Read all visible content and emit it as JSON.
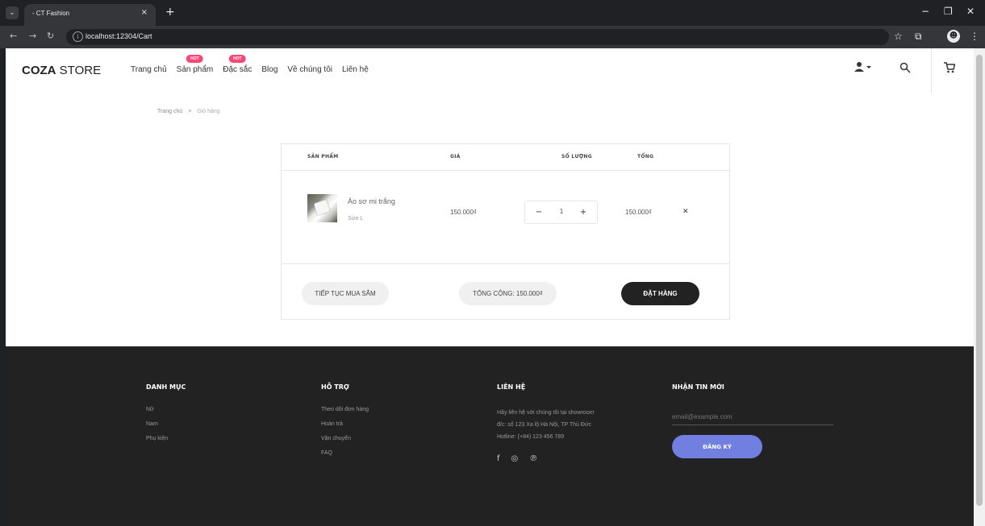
{
  "browser": {
    "tab_title": "- CT Fashion",
    "tab_close": "×",
    "new_tab": "+",
    "url": "localhost:12304/Cart",
    "minimize": "−",
    "restore": "❐",
    "close": "✕"
  },
  "header": {
    "logo_bold": "COZA",
    "logo_light": " STORE",
    "menu": [
      {
        "label": "Trang chủ",
        "badge": ""
      },
      {
        "label": "Sản phẩm",
        "badge": "HOT"
      },
      {
        "label": "Đặc sắc",
        "badge": "HOT"
      },
      {
        "label": "Blog",
        "badge": ""
      },
      {
        "label": "Về chúng tôi",
        "badge": ""
      },
      {
        "label": "Liên hệ",
        "badge": ""
      }
    ]
  },
  "breadcrumb": {
    "home": "Trang chủ",
    "separator": ">",
    "current": "Giỏ hàng"
  },
  "cart": {
    "columns": [
      "SẢN PHẨM",
      "GIÁ",
      "SỐ LƯỢNG",
      "TỔNG"
    ],
    "items": [
      {
        "name": "Áo sơ mi trắng",
        "size": "Size L",
        "price": "150.000₫",
        "quantity": "1",
        "total": "150.000₫"
      }
    ],
    "continue_label": "TIẾP TỤC MUA SẮM",
    "grand_total": "TỔNG CỘNG: 150.000₫",
    "order_label": "ĐẶT HÀNG"
  },
  "footer": {
    "categories": {
      "title": "DANH MỤC",
      "links": [
        "Nữ",
        "Nam",
        "Phụ kiện"
      ]
    },
    "support": {
      "title": "HỖ TRỢ",
      "links": [
        "Theo dõi đơn hàng",
        "Hoàn trả",
        "Vận chuyển",
        "FAQ"
      ]
    },
    "contact": {
      "title": "LIÊN HỆ",
      "lines": [
        "Hãy liên hệ với chúng tôi tại showroom",
        "đ/c: số 123 Xa lộ Hà Nội, TP Thủ Đức",
        "Hotline: (+84) 123 456 789"
      ]
    },
    "newsletter": {
      "title": "NHẬN TIN MỚI",
      "placeholder": "email@example.com",
      "button": "ĐĂNG KÝ"
    }
  },
  "colors": {
    "accent": "#717fe0",
    "hot_badge": "#f74877",
    "footer_bg": "#222222"
  },
  "icons": [
    "user-icon",
    "search-icon",
    "cart-icon",
    "facebook-icon",
    "instagram-icon",
    "pinterest-icon"
  ]
}
